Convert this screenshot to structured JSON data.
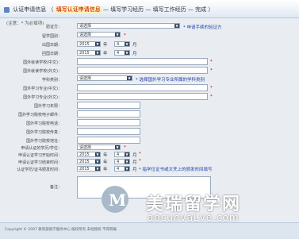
{
  "breadcrumb": {
    "current": "认证申请信息",
    "steps": [
      "填写认证申请信息",
      "填写学习经历",
      "填写工作经历",
      "完成"
    ],
    "separators": [
      "（",
      "—",
      "—",
      "—",
      "）"
    ]
  },
  "note": "(注意：* 为必填项)",
  "select_placeholder": "请选择",
  "year_default": "2015",
  "month_default": "4",
  "year_unit": "年",
  "month_unit": "月",
  "required_mark": "*",
  "form": {
    "verify_authority": {
      "label": "验证方：",
      "hint": "* 申请手续的验证方"
    },
    "study_country": {
      "label": "留学国别："
    },
    "departure_date": {
      "label": "出国日期："
    },
    "return_date": {
      "label": "回国日期："
    },
    "school_name_cn": {
      "label": "国外就读学校(中文)："
    },
    "school_name_en": {
      "label": "国外就读学校(外文)："
    },
    "discipline": {
      "label": "学科类别：",
      "hint": "* 选择国外学习专业所属的学科类别"
    },
    "major_cn": {
      "label": "国外学习专业(中文)："
    },
    "major_en": {
      "label": "国外学习专业(外文)："
    },
    "study_duration": {
      "label": "国外学习年限："
    },
    "study_email": {
      "label": "国外学习院校电子邮件："
    },
    "study_phone": {
      "label": "国外学习院校电话："
    },
    "study_fax": {
      "label": "国外学习院校传真："
    },
    "study_address": {
      "label": "国外学习院校地址："
    },
    "degree_type": {
      "label": "申请认证的学历/学位："
    },
    "cert_date": {
      "label": "申请认证学习开始时间："
    },
    "end_date": {
      "label": "申请认证学习结束时间："
    },
    "award_date": {
      "label": "认证学历/证书颁发时间：",
      "hint": "* 指学位证书或文凭上的颁发时间填写"
    },
    "remarks": {
      "label": "备注："
    }
  },
  "watermark": {
    "cn": "美瑞留学网",
    "en": "aocunvaLve.com"
  },
  "footer": "Copyright © 2007 教育部留学服务中心 版权所有 未经授权 不得转载"
}
